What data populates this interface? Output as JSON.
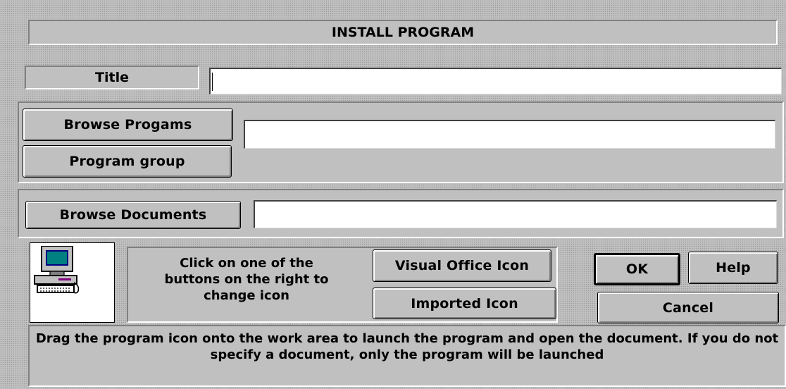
{
  "window": {
    "title": "INSTALL PROGRAM"
  },
  "title_row": {
    "label": "Title",
    "value": ""
  },
  "program": {
    "browse_label": "Browse Progams",
    "group_label": "Program group",
    "path_value": ""
  },
  "documents": {
    "browse_label": "Browse Documents",
    "path_value": ""
  },
  "icon_section": {
    "icon": "computer-icon",
    "instructions": "Click on one of the buttons on the right to change icon",
    "visual_office_label": "Visual Office Icon",
    "imported_label": "Imported Icon"
  },
  "actions": {
    "ok_label": "OK",
    "help_label": "Help",
    "cancel_label": "Cancel"
  },
  "footer": {
    "hint": "Drag the program icon onto the work area to launch the program and open the document. If you do not specify a document, only the program will be launched"
  }
}
